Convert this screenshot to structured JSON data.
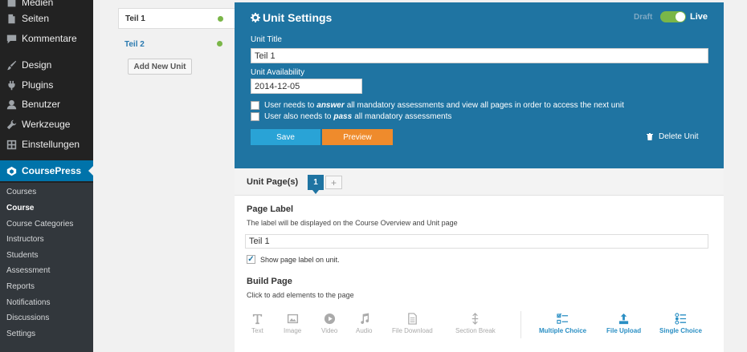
{
  "admin_menu": {
    "items": [
      {
        "label": "Medien",
        "icon": "media-icon"
      },
      {
        "label": "Seiten",
        "icon": "pages-icon"
      },
      {
        "label": "Kommentare",
        "icon": "comments-icon"
      },
      {
        "label": "Design",
        "icon": "brush-icon"
      },
      {
        "label": "Plugins",
        "icon": "plug-icon"
      },
      {
        "label": "Benutzer",
        "icon": "user-icon"
      },
      {
        "label": "Werkzeuge",
        "icon": "wrench-icon"
      },
      {
        "label": "Einstellungen",
        "icon": "settings-icon"
      }
    ],
    "active": {
      "label": "CoursePress",
      "icon": "coursepress-icon"
    },
    "submenu": [
      "Courses",
      "Course",
      "Course Categories",
      "Instructors",
      "Students",
      "Assessment",
      "Reports",
      "Notifications",
      "Discussions",
      "Settings"
    ],
    "current_submenu": "Course"
  },
  "units": [
    {
      "label": "Teil 1"
    },
    {
      "label": "Teil 2"
    }
  ],
  "add_unit_label": "Add New Unit",
  "unit_settings": {
    "title": "Unit Settings",
    "draft_label": "Draft",
    "live_label": "Live",
    "unit_title_label": "Unit Title",
    "unit_title_value": "Teil 1",
    "availability_label": "Unit Availability",
    "availability_value": "2014-12-05",
    "checkbox1": {
      "pre": "User needs to",
      "em": "answer",
      "post": "all mandatory assessments and view all pages in order to access the next unit"
    },
    "checkbox2": {
      "pre": "User also needs to",
      "em": "pass",
      "post": "all mandatory assessments"
    },
    "save_label": "Save",
    "preview_label": "Preview",
    "delete_label": "Delete Unit"
  },
  "unit_pages": {
    "label": "Unit Page(s)",
    "current_tab": "1",
    "add_tab": "+"
  },
  "page": {
    "label_heading": "Page Label",
    "label_desc": "The label will be displayed on the Course Overview and Unit page",
    "label_value": "Teil 1",
    "show_label": "Show page label on unit.",
    "build_heading": "Build Page",
    "build_desc": "Click to add elements to the page"
  },
  "elements": [
    {
      "label": "Text",
      "icon": "text-icon"
    },
    {
      "label": "Image",
      "icon": "image-icon"
    },
    {
      "label": "Video",
      "icon": "video-icon"
    },
    {
      "label": "Audio",
      "icon": "audio-icon"
    },
    {
      "label": "File Download",
      "icon": "file-icon"
    },
    {
      "label": "Section Break",
      "icon": "section-break-icon"
    },
    {
      "label": "Multiple Choice",
      "icon": "multiple-choice-icon"
    },
    {
      "label": "File Upload",
      "icon": "file-upload-icon"
    },
    {
      "label": "Single Choice",
      "icon": "single-choice-icon"
    }
  ],
  "colors": {
    "accent": "#1f74a2",
    "live_toggle": "#7ab648",
    "save": "#29a3d6",
    "preview": "#ef8b2c",
    "wp_active": "#0073aa"
  }
}
